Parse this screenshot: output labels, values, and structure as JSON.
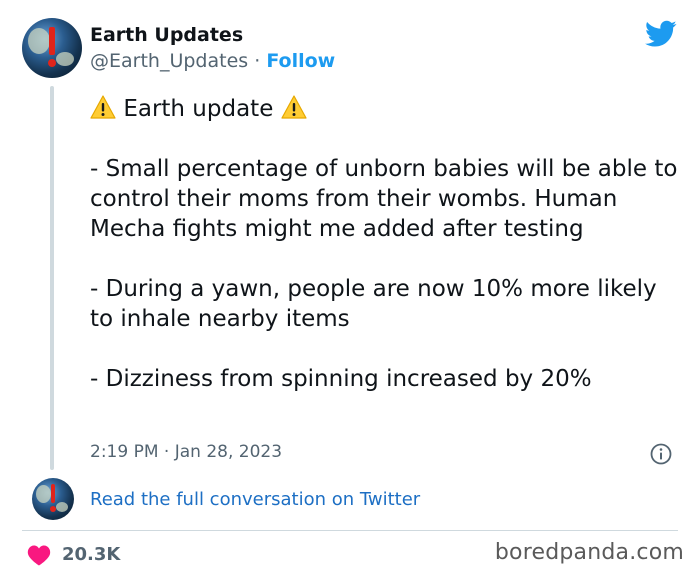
{
  "tweet": {
    "author_name": "Earth Updates",
    "handle": "@Earth_Updates",
    "separator": "·",
    "follow_label": "Follow",
    "title_text": "Earth update",
    "paragraphs": [
      "- Small percentage of unborn babies will be able to control their moms from their wombs. Human Mecha fights might me added after testing",
      "- During a yawn, people are now 10% more likely to inhale nearby items",
      "- Dizziness from spinning increased by 20%"
    ],
    "timestamp": "2:19 PM · Jan 28, 2023",
    "read_conversation_label": "Read the full conversation on Twitter",
    "like_count": "20.3K"
  },
  "watermark": "boredpanda.com",
  "icons": {
    "brand": "twitter-bird-icon",
    "warning": "warning-icon",
    "info": "info-icon",
    "like": "heart-icon"
  },
  "colors": {
    "link": "#1d9bf0",
    "heart": "#f91880",
    "warning": "#ffcc33"
  }
}
